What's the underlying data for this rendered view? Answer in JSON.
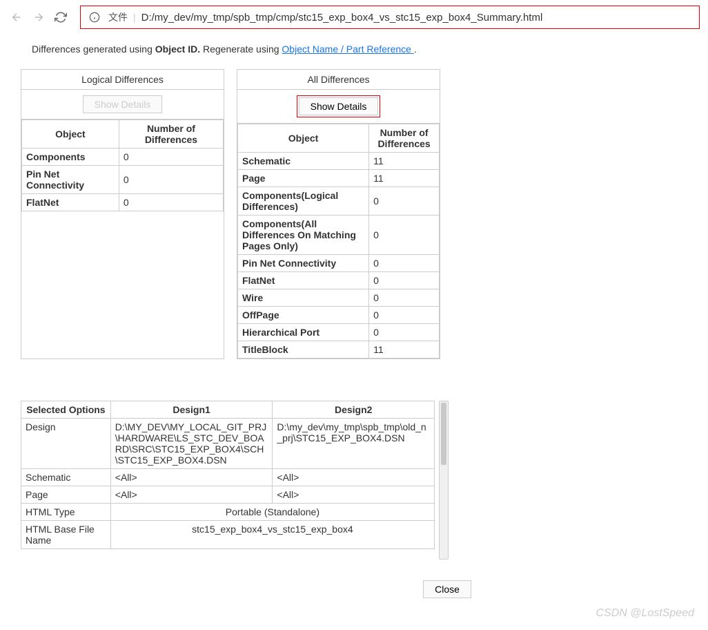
{
  "browser": {
    "file_label": "文件",
    "url": "D:/my_dev/my_tmp/spb_tmp/cmp/stc15_exp_box4_vs_stc15_exp_box4_Summary.html"
  },
  "intro": {
    "prefix": "Differences generated using ",
    "bold": "Object ID.",
    "mid": " Regenerate using ",
    "link": "Object Name / Part Reference ",
    "suffix": "."
  },
  "logical": {
    "title": "Logical Differences",
    "show_btn": "Show Details",
    "col_obj": "Object",
    "col_num": "Number of Differences",
    "rows": [
      {
        "obj": "Components",
        "num": "0"
      },
      {
        "obj": "Pin Net Connectivity",
        "num": "0"
      },
      {
        "obj": "FlatNet",
        "num": "0"
      }
    ]
  },
  "all": {
    "title": "All Differences",
    "show_btn": "Show Details",
    "col_obj": "Object",
    "col_num": "Number of Differences",
    "rows": [
      {
        "obj": "Schematic",
        "num": "11"
      },
      {
        "obj": "Page",
        "num": "11"
      },
      {
        "obj": "Components(Logical Differences)",
        "num": "0"
      },
      {
        "obj": "Components(All Differences On Matching Pages Only)",
        "num": "0"
      },
      {
        "obj": "Pin Net Connectivity",
        "num": "0"
      },
      {
        "obj": "FlatNet",
        "num": "0"
      },
      {
        "obj": "Wire",
        "num": "0"
      },
      {
        "obj": "OffPage",
        "num": "0"
      },
      {
        "obj": "Hierarchical Port",
        "num": "0"
      },
      {
        "obj": "TitleBlock",
        "num": "11"
      }
    ]
  },
  "opts": {
    "h_sel": "Selected Options",
    "h_d1": "Design1",
    "h_d2": "Design2",
    "r_design": "Design",
    "r_design_d1": "D:\\MY_DEV\\MY_LOCAL_GIT_PRJ\\HARDWARE\\LS_STC_DEV_BOARD\\SRC\\STC15_EXP_BOX4\\SCH\\STC15_EXP_BOX4.DSN",
    "r_design_d2": "D:\\my_dev\\my_tmp\\spb_tmp\\old_n_prj\\STC15_EXP_BOX4.DSN",
    "r_sch": "Schematic",
    "r_sch_v": "<All>",
    "r_page": "Page",
    "r_page_v": "<All>",
    "r_html": "HTML Type",
    "r_html_v": "Portable (Standalone)",
    "r_base": "HTML Base File Name",
    "r_base_v": "stc15_exp_box4_vs_stc15_exp_box4"
  },
  "close_btn": "Close",
  "watermark": "CSDN @LostSpeed"
}
